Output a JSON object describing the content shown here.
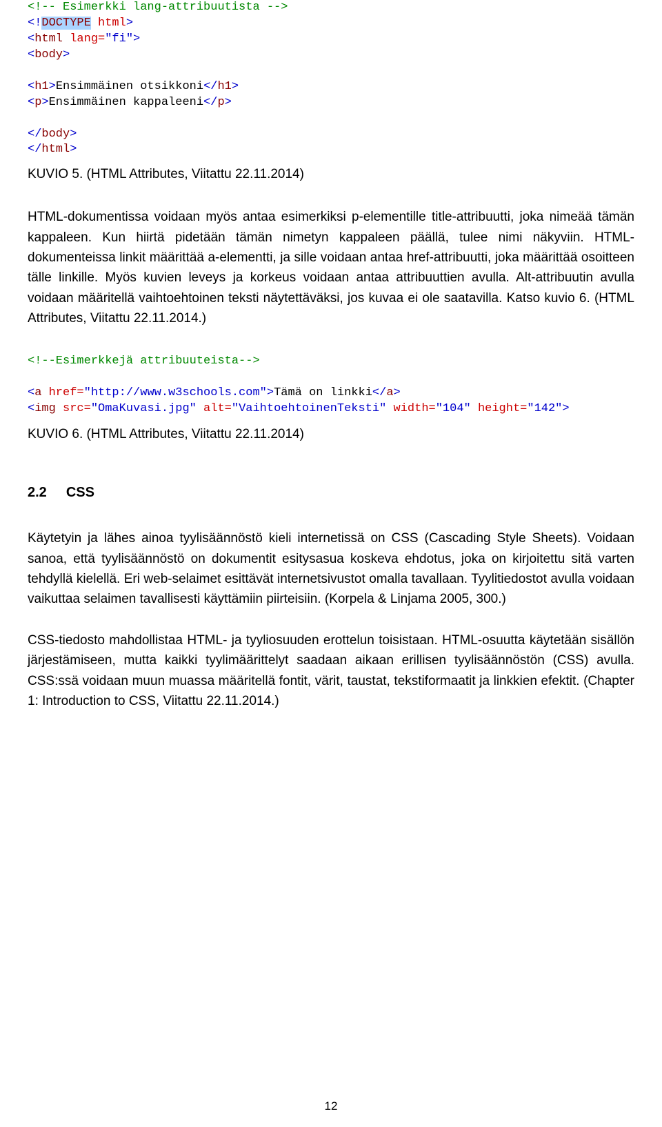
{
  "code1": {
    "comment": "<!-- Esimerkki lang-attribuutista -->",
    "doctype_open": "<!",
    "doctype_name": "DOCTYPE",
    "doctype_rest": " html",
    "doctype_close": ">",
    "html_open_open": "<",
    "html_open_name": "html",
    "html_lang_attr": " lang=",
    "html_lang_val": "\"fi\"",
    "html_open_close": ">",
    "body_open_open": "<",
    "body_open_name": "body",
    "body_open_close": ">",
    "h1_open_open": "<",
    "h1_open_name": "h1",
    "h1_open_close": ">",
    "h1_text": "Ensimmäinen otsikkoni",
    "h1_close_open": "</",
    "h1_close_name": "h1",
    "h1_close_close": ">",
    "p_open_open": "<",
    "p_open_name": "p",
    "p_open_close": ">",
    "p_text": "Ensimmäinen kappaleeni",
    "p_close_open": "</",
    "p_close_name": "p",
    "p_close_close": ">",
    "body_close_open": "</",
    "body_close_name": "body",
    "body_close_close": ">",
    "html_close_open": "</",
    "html_close_name": "html",
    "html_close_close": ">"
  },
  "caption1": "KUVIO 5. (HTML Attributes, Viitattu 22.11.2014)",
  "para1": "HTML-dokumentissa voidaan myös antaa esimerkiksi p-elementille title-attribuutti, joka nimeää tämän kappaleen. Kun hiirtä pidetään tämän nimetyn kappaleen päällä, tulee nimi näkyviin. HTML-dokumenteissa linkit määrittää a-elementti, ja sille voidaan antaa href-attribuutti, joka määrittää osoitteen tälle linkille. Myös kuvien leveys ja korkeus voidaan antaa attribuuttien avulla. Alt-attribuutin avulla voidaan määritellä vaihtoehtoinen teksti näytettäväksi, jos kuvaa ei ole saatavilla. Katso kuvio 6. (HTML Attributes, Viitattu 22.11.2014.)",
  "code2": {
    "comment": "<!--Esimerkkejä attribuuteista-->",
    "a_open_open": "<",
    "a_open_name": "a",
    "a_href_attr": " href=",
    "a_href_val": "\"http://www.w3schools.com\"",
    "a_open_close": ">",
    "a_text": "Tämä on linkki",
    "a_close_open": "</",
    "a_close_name": "a",
    "a_close_close": ">",
    "img_open_open": "<",
    "img_open_name": "img",
    "img_src_attr": " src=",
    "img_src_val": "\"OmaKuvasi.jpg\"",
    "img_alt_attr": " alt=",
    "img_alt_val": "\"VaihtoehtoinenTeksti\"",
    "img_w_attr": " width=",
    "img_w_val": "\"104\"",
    "img_h_attr": " height=",
    "img_h_val": "\"142\"",
    "img_close": ">"
  },
  "caption2": "KUVIO 6. (HTML Attributes, Viitattu 22.11.2014)",
  "section_num": "2.2",
  "section_title": "CSS",
  "para2": "Käytetyin ja lähes ainoa tyylisäännöstö kieli internetissä on CSS (Cascading Style Sheets). Voidaan sanoa, että tyylisäännöstö on dokumentit esitysasua koskeva ehdotus, joka on kirjoitettu sitä varten tehdyllä kielellä. Eri web-selaimet esittävät internetsivustot omalla tavallaan. Tyylitiedostot avulla voidaan vaikuttaa selaimen tavallisesti käyttämiin piirteisiin. (Korpela & Linjama 2005, 300.)",
  "para3": "CSS-tiedosto mahdollistaa HTML- ja tyyliosuuden erottelun toisistaan. HTML-osuutta käytetään sisällön järjestämiseen, mutta kaikki tyylimäärittelyt saadaan aikaan erillisen tyylisäännöstön (CSS) avulla. CSS:ssä voidaan muun muassa määritellä fontit, värit, taustat, tekstiformaatit ja linkkien efektit. (Chapter 1: Introduction to CSS, Viitattu 22.11.2014.)",
  "page_number": "12"
}
